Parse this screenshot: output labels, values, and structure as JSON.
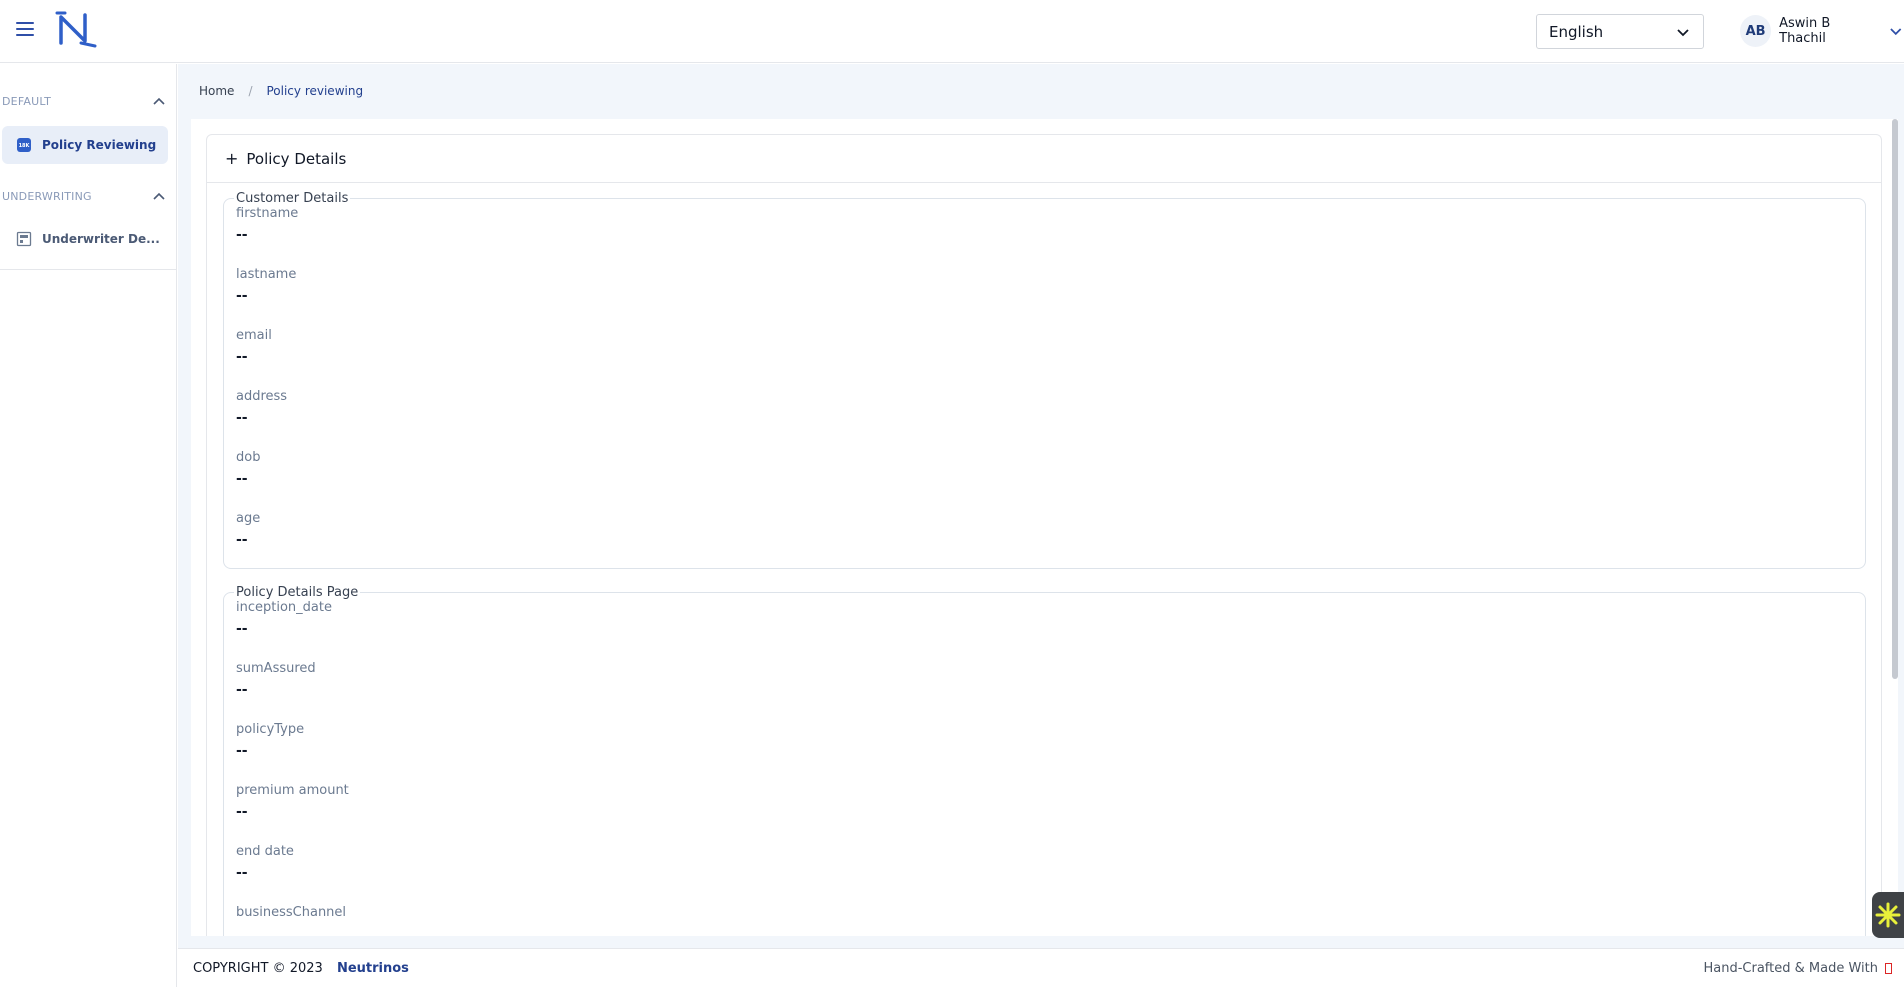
{
  "header": {
    "language": {
      "selected": "English"
    },
    "user": {
      "initials": "AB",
      "name": "Aswin B Thachil"
    }
  },
  "sidebar": {
    "sections": [
      {
        "label": "DEFAULT",
        "items": [
          {
            "label": "Policy Reviewing",
            "active": true
          }
        ]
      },
      {
        "label": "UNDERWRITING",
        "items": [
          {
            "label": "Underwriter De...",
            "active": false
          }
        ]
      }
    ]
  },
  "breadcrumb": {
    "home": "Home",
    "separator": "/",
    "current": "Policy reviewing"
  },
  "card": {
    "title": "Policy Details",
    "toggle_symbol": "+",
    "customer_details": {
      "legend": "Customer Details",
      "fields": [
        {
          "label": "firstname",
          "value": "--"
        },
        {
          "label": "lastname",
          "value": "--"
        },
        {
          "label": "email",
          "value": "--"
        },
        {
          "label": "address",
          "value": "--"
        },
        {
          "label": "dob",
          "value": "--"
        },
        {
          "label": "age",
          "value": "--"
        }
      ]
    },
    "policy_details_page": {
      "legend": "Policy Details Page",
      "fields": [
        {
          "label": "inception_date",
          "value": "--"
        },
        {
          "label": "sumAssured",
          "value": "--"
        },
        {
          "label": "policyType",
          "value": "--"
        },
        {
          "label": "premium amount",
          "value": "--"
        },
        {
          "label": "end date",
          "value": "--"
        },
        {
          "label": "businessChannel",
          "value": ""
        }
      ]
    }
  },
  "footer": {
    "copyright": "COPYRIGHT © 2023",
    "brand": "Neutrinos",
    "made_with": "Hand-Crafted & Made With"
  },
  "colors": {
    "accent": "#23408e",
    "sidebar_active_bg": "#e8eef8",
    "main_bg": "#f2f6fb"
  }
}
